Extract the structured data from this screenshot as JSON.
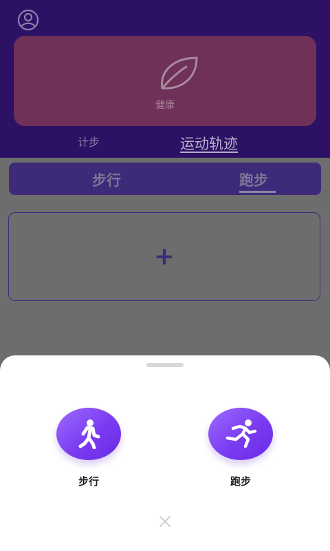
{
  "header": {
    "health_card": {
      "label": "健康",
      "icon": "leaf-icon"
    },
    "tabs": [
      {
        "label": "计步"
      },
      {
        "label": "运动轨迹"
      }
    ]
  },
  "mode_bar": {
    "tabs": [
      {
        "label": "步行"
      },
      {
        "label": "跑步",
        "selected": true
      }
    ]
  },
  "add_panel": {
    "label": "+"
  },
  "sheet": {
    "options": [
      {
        "label": "步行",
        "icon": "walking-person-icon"
      },
      {
        "label": "跑步",
        "icon": "running-person-icon"
      }
    ],
    "close_icon": "close-icon"
  },
  "colors": {
    "header_bg": "#2c1164",
    "accent_purple": "#7a3bf0",
    "sheet_bg": "#ffffff"
  }
}
